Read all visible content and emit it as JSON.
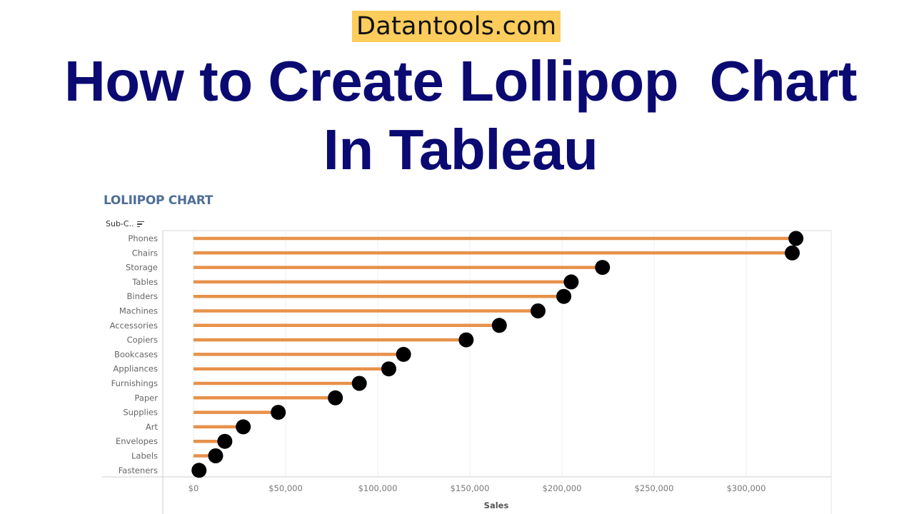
{
  "brand": "Datantools.com",
  "headline": {
    "line1": "How to Create Lollipop  Chart",
    "line2": "In Tableau"
  },
  "colors": {
    "brand_bg": "#fccc5c",
    "headline": "#0b0a72",
    "chart_title": "#4f6f96",
    "stick": "#e8914a",
    "dot": "#000000"
  },
  "sheet": {
    "row_header": "Sub-C..",
    "row_header_icon": "sort-descending-icon"
  },
  "chart_data": {
    "type": "lollipop",
    "orientation": "horizontal",
    "title": "LOLIIPOP CHART",
    "xlabel": "Sales",
    "ylabel": "Sub-Category",
    "xlim": [
      0,
      345000
    ],
    "grid": true,
    "x_ticks": [
      0,
      50000,
      100000,
      150000,
      200000,
      250000,
      300000
    ],
    "x_tick_labels": [
      "$0",
      "$50,000",
      "$100,000",
      "$150,000",
      "$200,000",
      "$250,000",
      "$300,000"
    ],
    "categories": [
      "Phones",
      "Chairs",
      "Storage",
      "Tables",
      "Binders",
      "Machines",
      "Accessories",
      "Copiers",
      "Bookcases",
      "Appliances",
      "Furnishings",
      "Paper",
      "Supplies",
      "Art",
      "Envelopes",
      "Labels",
      "Fasteners"
    ],
    "values": [
      327000,
      325000,
      222000,
      205000,
      201000,
      187000,
      166000,
      148000,
      114000,
      106000,
      90000,
      77000,
      46000,
      27000,
      17000,
      12000,
      3000
    ]
  }
}
